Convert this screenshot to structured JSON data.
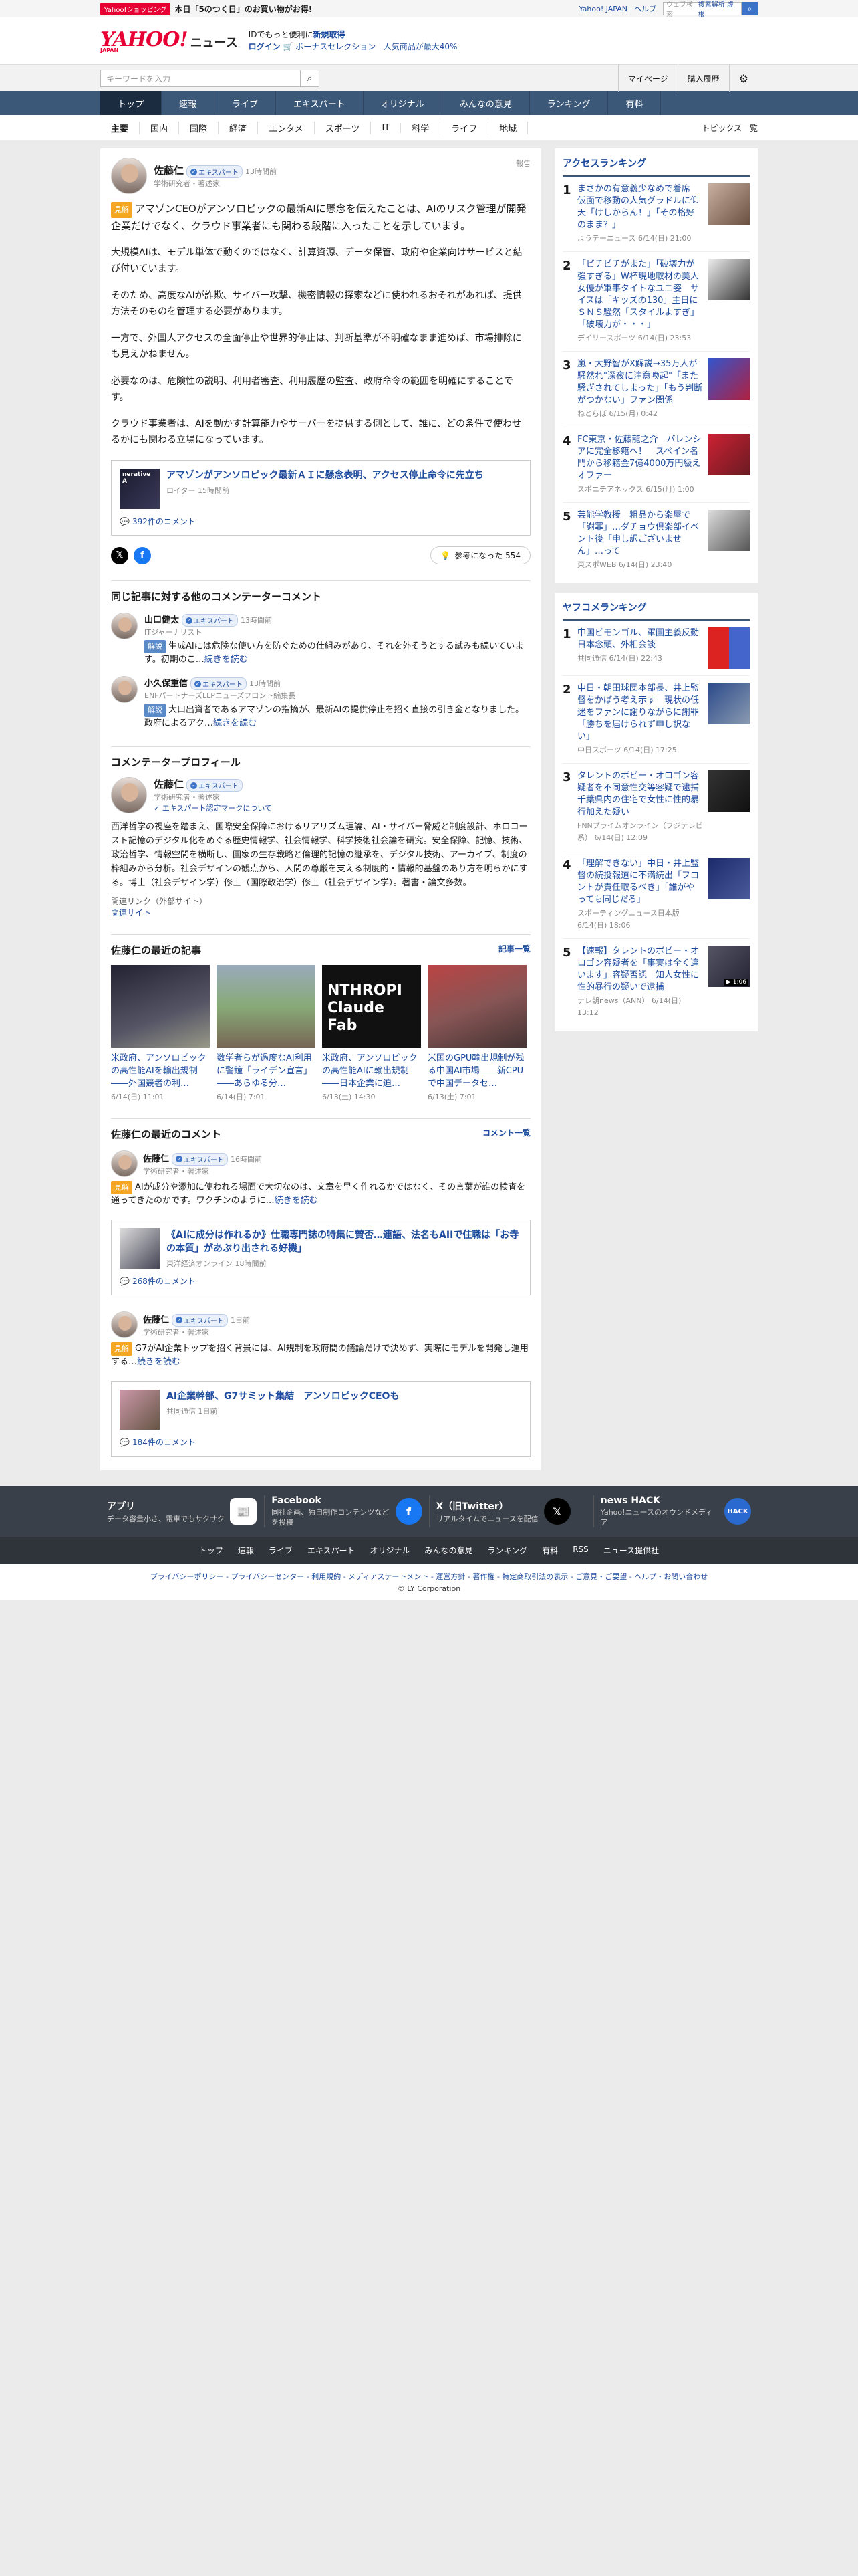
{
  "topstrip": {
    "promo_tag": "Yahoo!ショッピング",
    "promo_text": "本日「5のつく日」のお買い物がお得!",
    "links": [
      "Yahoo! JAPAN",
      "ヘルプ"
    ],
    "websearch_placeholder": "ウェブ検索",
    "websearch_hint": "複素解析 虚根"
  },
  "header": {
    "logo_main": "YAHOO!",
    "logo_sub": "JAPAN",
    "logo_news": "ニュース",
    "line1_text": "IDでもっと便利に",
    "line1_link": "新規取得",
    "login": "ログイン",
    "bonus": "ボーナスセレクション",
    "popular": "人気商品が最大40%"
  },
  "search": {
    "placeholder": "キーワードを入力",
    "right_items": [
      "マイページ",
      "購入履歴"
    ]
  },
  "nav": {
    "tabs": [
      "トップ",
      "速報",
      "ライブ",
      "エキスパート",
      "オリジナル",
      "みんなの意見",
      "ランキング",
      "有料"
    ],
    "sub": [
      "主要",
      "国内",
      "国際",
      "経済",
      "エンタメ",
      "スポーツ",
      "IT",
      "科学",
      "ライフ",
      "地域"
    ],
    "topics_all": "トピックス一覧"
  },
  "article": {
    "author_name": "佐藤仁",
    "badge": "エキスパート",
    "time": "13時間前",
    "role": "学術研究者・著述家",
    "report": "報告",
    "kaisetsu": "見解",
    "lead": "アマゾンCEOがアンソロピックの最新AIに懸念を伝えたことは、AIのリスク管理が開発企業だけでなく、クラウド事業者にも関わる段階に入ったことを示しています。",
    "paras": [
      "大規模AIは、モデル単体で動くのではなく、計算資源、データ保管、政府や企業向けサービスと結び付いています。",
      "そのため、高度なAIが詐欺、サイバー攻撃、機密情報の探索などに使われるおそれがあれば、提供方法そのものを管理する必要があります。",
      "一方で、外国人アクセスの全面停止や世界的停止は、判断基準が不明確なまま進めば、市場排除にも見えかねません。",
      "必要なのは、危険性の説明、利用者審査、利用履歴の監査、政府命令の範囲を明確にすることです。",
      "クラウド事業者は、AIを動かす計算能力やサーバーを提供する側として、誰に、どの条件で使わせるかにも関わる立場になっています。"
    ],
    "link_title": "アマゾンがアンソロピック最新ＡＩに懸念表明、アクセス停止命令に先立ち",
    "link_source": "ロイター 15時間前",
    "link_thumb_text": "nerative A",
    "comments": "392件のコメント",
    "helpful": "参考になった 554"
  },
  "others": {
    "title": "同じ記事に対する他のコメンテーターコメント",
    "items": [
      {
        "name": "山口健太",
        "badge": "エキスパート",
        "time": "13時間前",
        "role": "ITジャーナリスト",
        "tag": "解説",
        "text": "生成AIには危険な使い方を防ぐための仕組みがあり、それを外そうとする試みも続いています。初期のこ…",
        "more": "続きを読む"
      },
      {
        "name": "小久保重信",
        "badge": "エキスパート",
        "time": "13時間前",
        "role": "ENFパートナーズLLPニューズフロント編集長",
        "tag": "解説",
        "text": "大口出資者であるアマゾンの指摘が、最新AIの提供停止を招く直接の引き金となりました。政府によるアク…",
        "more": "続きを読む"
      }
    ]
  },
  "profile": {
    "title": "コメンテータープロフィール",
    "name": "佐藤仁",
    "badge": "エキスパート",
    "role": "学術研究者・著述家",
    "mark": "エキスパート認定マークについて",
    "text": "西洋哲学の視座を踏まえ、国際安全保障におけるリアリズム理論、AI・サイバー脅威と制度設計、ホロコースト記憶のデジタル化をめぐる歴史情報学、社会情報学、科学技術社会論を研究。安全保障、記憶、技術、政治哲学、情報空間を横断し、国家の生存戦略と倫理的記憶の継承を、デジタル技術、アーカイブ、制度の枠組みから分析。社会デザインの観点から、人間の尊厳を支える制度的・情報的基盤のあり方を明らかにする。博士（社会デザイン学）修士（国際政治学）修士（社会デザイン学）。著書・論文多数。",
    "rel_label": "関連リンク（外部サイト）",
    "rel_link": "関連サイト"
  },
  "recent_articles": {
    "title": "佐藤仁の最近の記事",
    "more": "記事一覧",
    "items": [
      {
        "t": "米政府、アンソロピックの高性能AIを輸出規制――外国競者の利…",
        "d": "6/14(日) 11:01",
        "thumb": ""
      },
      {
        "t": "数学者らが過度なAI利用に警鐘「ライデン宣言」――あらゆる分…",
        "d": "6/14(日) 7:01",
        "thumb": ""
      },
      {
        "t": "米政府、アンソロピックの高性能AIに輸出規制――日本企業に迫…",
        "d": "6/13(土) 14:30",
        "thumb": "NTHROPI\nClaude Fab"
      },
      {
        "t": "米国のGPU輸出規制が残る中国AI市場――新CPUで中国データセ…",
        "d": "6/13(土) 7:01",
        "thumb": ""
      }
    ]
  },
  "recent_comments": {
    "title": "佐藤仁の最近のコメント",
    "more": "コメント一覧",
    "items": [
      {
        "name": "佐藤仁",
        "badge": "エキスパート",
        "time": "16時間前",
        "role": "学術研究者・著述家",
        "tag": "見解",
        "text": "AIが成分や添加に使われる場面で大切なのは、文章を早く作れるかではなく、その言葉が誰の検査を通ってきたのかです。ワクチンのように…",
        "more": "続きを読む",
        "link_title": "《AIに成分は作れるか》仕職専門誌の特集に賛否…連語、法名もAIIで住職は「お寺の本質」があぶり出される好機」",
        "link_source": "東洋経済オンライン 18時間前",
        "comments": "268件のコメント"
      },
      {
        "name": "佐藤仁",
        "badge": "エキスパート",
        "time": "1日前",
        "role": "学術研究者・著述家",
        "tag": "見解",
        "text": "G7がAI企業トップを招く背景には、AI規制を政府間の議論だけで決めず、実際にモデルを開発し運用する…",
        "more": "続きを読む",
        "link_title": "AI企業幹部、G7サミット集結　アンソロピックCEOも",
        "link_source": "共同通信 1日前",
        "comments": "184件のコメント"
      }
    ]
  },
  "access_ranking": {
    "title": "アクセスランキング",
    "items": [
      {
        "n": "1",
        "t": "まさかの有意義少なめで着席　仮面で移動の人気グラドルに仰天「けしからん！」「その格好のまま？」",
        "s": "ようテーニュース 6/14(日) 21:00"
      },
      {
        "n": "2",
        "t": "「ビチビチがまた」「破壊力が強すぎる」W杯現地取材の美人女優が軍事タイトなユニ姿　サイスは「キッズの130」主日にＳＮＳ騒然「スタイルよすぎ」「破壊力が・・・」",
        "s": "デイリースポーツ 6/14(日) 23:53"
      },
      {
        "n": "3",
        "t": "嵐・大野智がX解説→35万人が騒然れ\"深夜に注意喚起\"「また騒ぎされてしまった」「もう判断がつかない」ファン関係",
        "s": "ねとらぼ 6/15(月) 0:42"
      },
      {
        "n": "4",
        "t": "FC東京・佐藤龍之介　バレンシアに完全移籍へ！　スペイン名門から移籍金7億4000万円級えオファー",
        "s": "スポニチアネックス 6/15(月) 1:00"
      },
      {
        "n": "5",
        "t": "芸能学教授　粗品から楽屋で「謝罪」…ダチョウ倶楽部イベント後「申し訳ございません」…って",
        "s": "東スポWEB 6/14(日) 23:40"
      }
    ]
  },
  "yafuko_ranking": {
    "title": "ヤフコメランキング",
    "items": [
      {
        "n": "1",
        "t": "中国ビモンゴル、軍国主義反動日本念頭、外相会談",
        "s": "共同通信 6/14(日) 22:43"
      },
      {
        "n": "2",
        "t": "中日・朝田球団本部長、井上監督をかばう考え示す　現状の低迷をファンに謝りながらに謝罪「勝ちを届けられず申し訳ない」",
        "s": "中日スポーツ 6/14(日) 17:25"
      },
      {
        "n": "3",
        "t": "タレントのボビー・オロゴン容疑者を不同意性交等容疑で逮捕　千葉県内の住宅で女性に性的暴行加えた疑い",
        "s": "FNNプライムオンライン（フジテレビ系） 6/14(日) 12:09"
      },
      {
        "n": "4",
        "t": "「理解できない」中日・井上監督の続投報道に不満続出「フロントが責任取るべき」「誰がやっても同じだろ」",
        "s": "スポーティングニュース日本版 6/14(日) 18:06"
      },
      {
        "n": "5",
        "t": "【速報】タレントのボビー・オロゴン容疑者を「事実は全く違います」容疑否認　知人女性に性的暴行の疑いで逮捕",
        "s": "テレ朝news（ANN） 6/14(日) 13:12",
        "badge": "▶ 1:06"
      }
    ]
  },
  "footer": {
    "apps": [
      {
        "t": "アプリ",
        "s": "データ容量小さ、電車でもサクサク"
      },
      {
        "t": "Facebook",
        "s": "同社企画、独自制作コンテンツなどを投稿"
      },
      {
        "t": "X（旧Twitter）",
        "s": "リアルタイムでニュースを配信"
      },
      {
        "t": "news HACK",
        "s": "Yahoo!ニュースのオウンドメディア"
      }
    ],
    "links": [
      "トップ",
      "速報",
      "ライブ",
      "エキスパート",
      "オリジナル",
      "みんなの意見",
      "ランキング",
      "有料",
      "RSS",
      "ニュース提供社"
    ],
    "legal": "プライバシーポリシー - プライバシーセンター - 利用規約 - メディアステートメント - 運営方針 - 著作権 - 特定商取引法の表示 - ご意見・ご要望 - ヘルプ・お問い合わせ",
    "copyright": "© LY Corporation"
  },
  "colors": {
    "brand_red": "#e60033",
    "nav": "#3c5878",
    "link": "#1d4b9e"
  }
}
